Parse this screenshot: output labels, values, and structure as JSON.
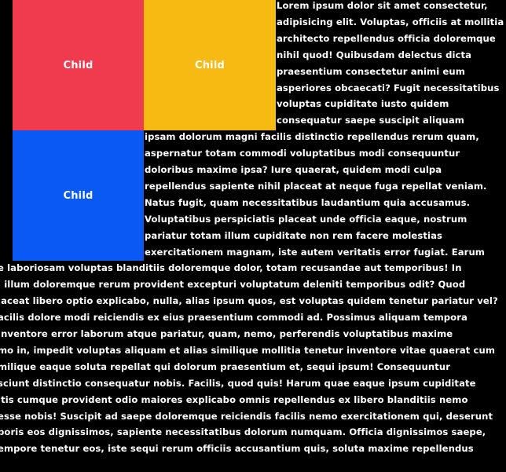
{
  "children": {
    "red": {
      "label": "Child",
      "color": "#ef3b4d"
    },
    "yellow": {
      "label": "Child",
      "color": "#f6ba12"
    },
    "blue": {
      "label": "Child",
      "color": "#0a59f4"
    }
  },
  "paragraph": {
    "lines": [
      "Lorem ipsum dolor sit amet consectetur,",
      "adipisicing elit. Voluptas, officiis at mollitia",
      "architecto repellendus officia doloremque",
      "nihil quod! Quibusdam delectus dicta",
      "praesentium consectetur animi eum",
      "asperiores obcaecati? Fugit necessitatibus",
      "voluptas cupiditate iusto quidem",
      "consequatur saepe suscipit aliquam",
      "ipsam dolorum magni facilis distinctio repellendus rerum quam,",
      "aspernatur totam commodi voluptatibus modi consequuntur",
      "doloribus maxime ipsa? Iure quaerat, quidem modi culpa",
      "repellendus sapiente nihil placeat at neque fuga repellat veniam.",
      "Natus fugit, quam necessitatibus laudantium quia accusamus.",
      "Voluptatibus perspiciatis placeat unde officia eaque, nostrum",
      "pariatur totam illum cupiditate non rem facere molestias",
      "exercitationem magnam, iste autem veritatis error fugiat. Earum",
      "e laboriosam voluptas blanditiis doloremque dolor, totam recusandae aut temporibus! In",
      "i illum doloremque rerum provident excepturi voluptatum deleniti temporibus odit? Quod",
      "laceat libero optio explicabo, nulla, alias ipsum quos, est voluptas quidem tenetur pariatur vel?",
      "acilis dolore modi reiciendis ex eius praesentium commodi ad. Possimus aliquam tempora",
      "inventore error laborum atque pariatur, quam, nemo, perferendis voluptatibus maxime",
      "mo in, impedit voluptas aliquam et alias similique mollitia tenetur inventore vitae quaerat cum",
      "milique eaque soluta repellat qui dolorum praesentium et, sequi ipsum! Consequuntur",
      "sciunt distinctio consequatur nobis. Facilis, quod quis! Harum quae eaque ipsum cupiditate",
      "itis cumque provident odio maiores explicabo omnis repellendus ex libero blanditiis nemo",
      "esse nobis! Suscipit ad saepe doloremque reiciendis facilis nemo exercitationem qui, deserunt",
      "poris eos dignissimos, sapiente necessitatibus dolorum numquam. Officia dignissimos saepe,",
      "empore tenetur eos, iste sequi rerum officiis accusantium quis, soluta maxime repellendus"
    ]
  }
}
